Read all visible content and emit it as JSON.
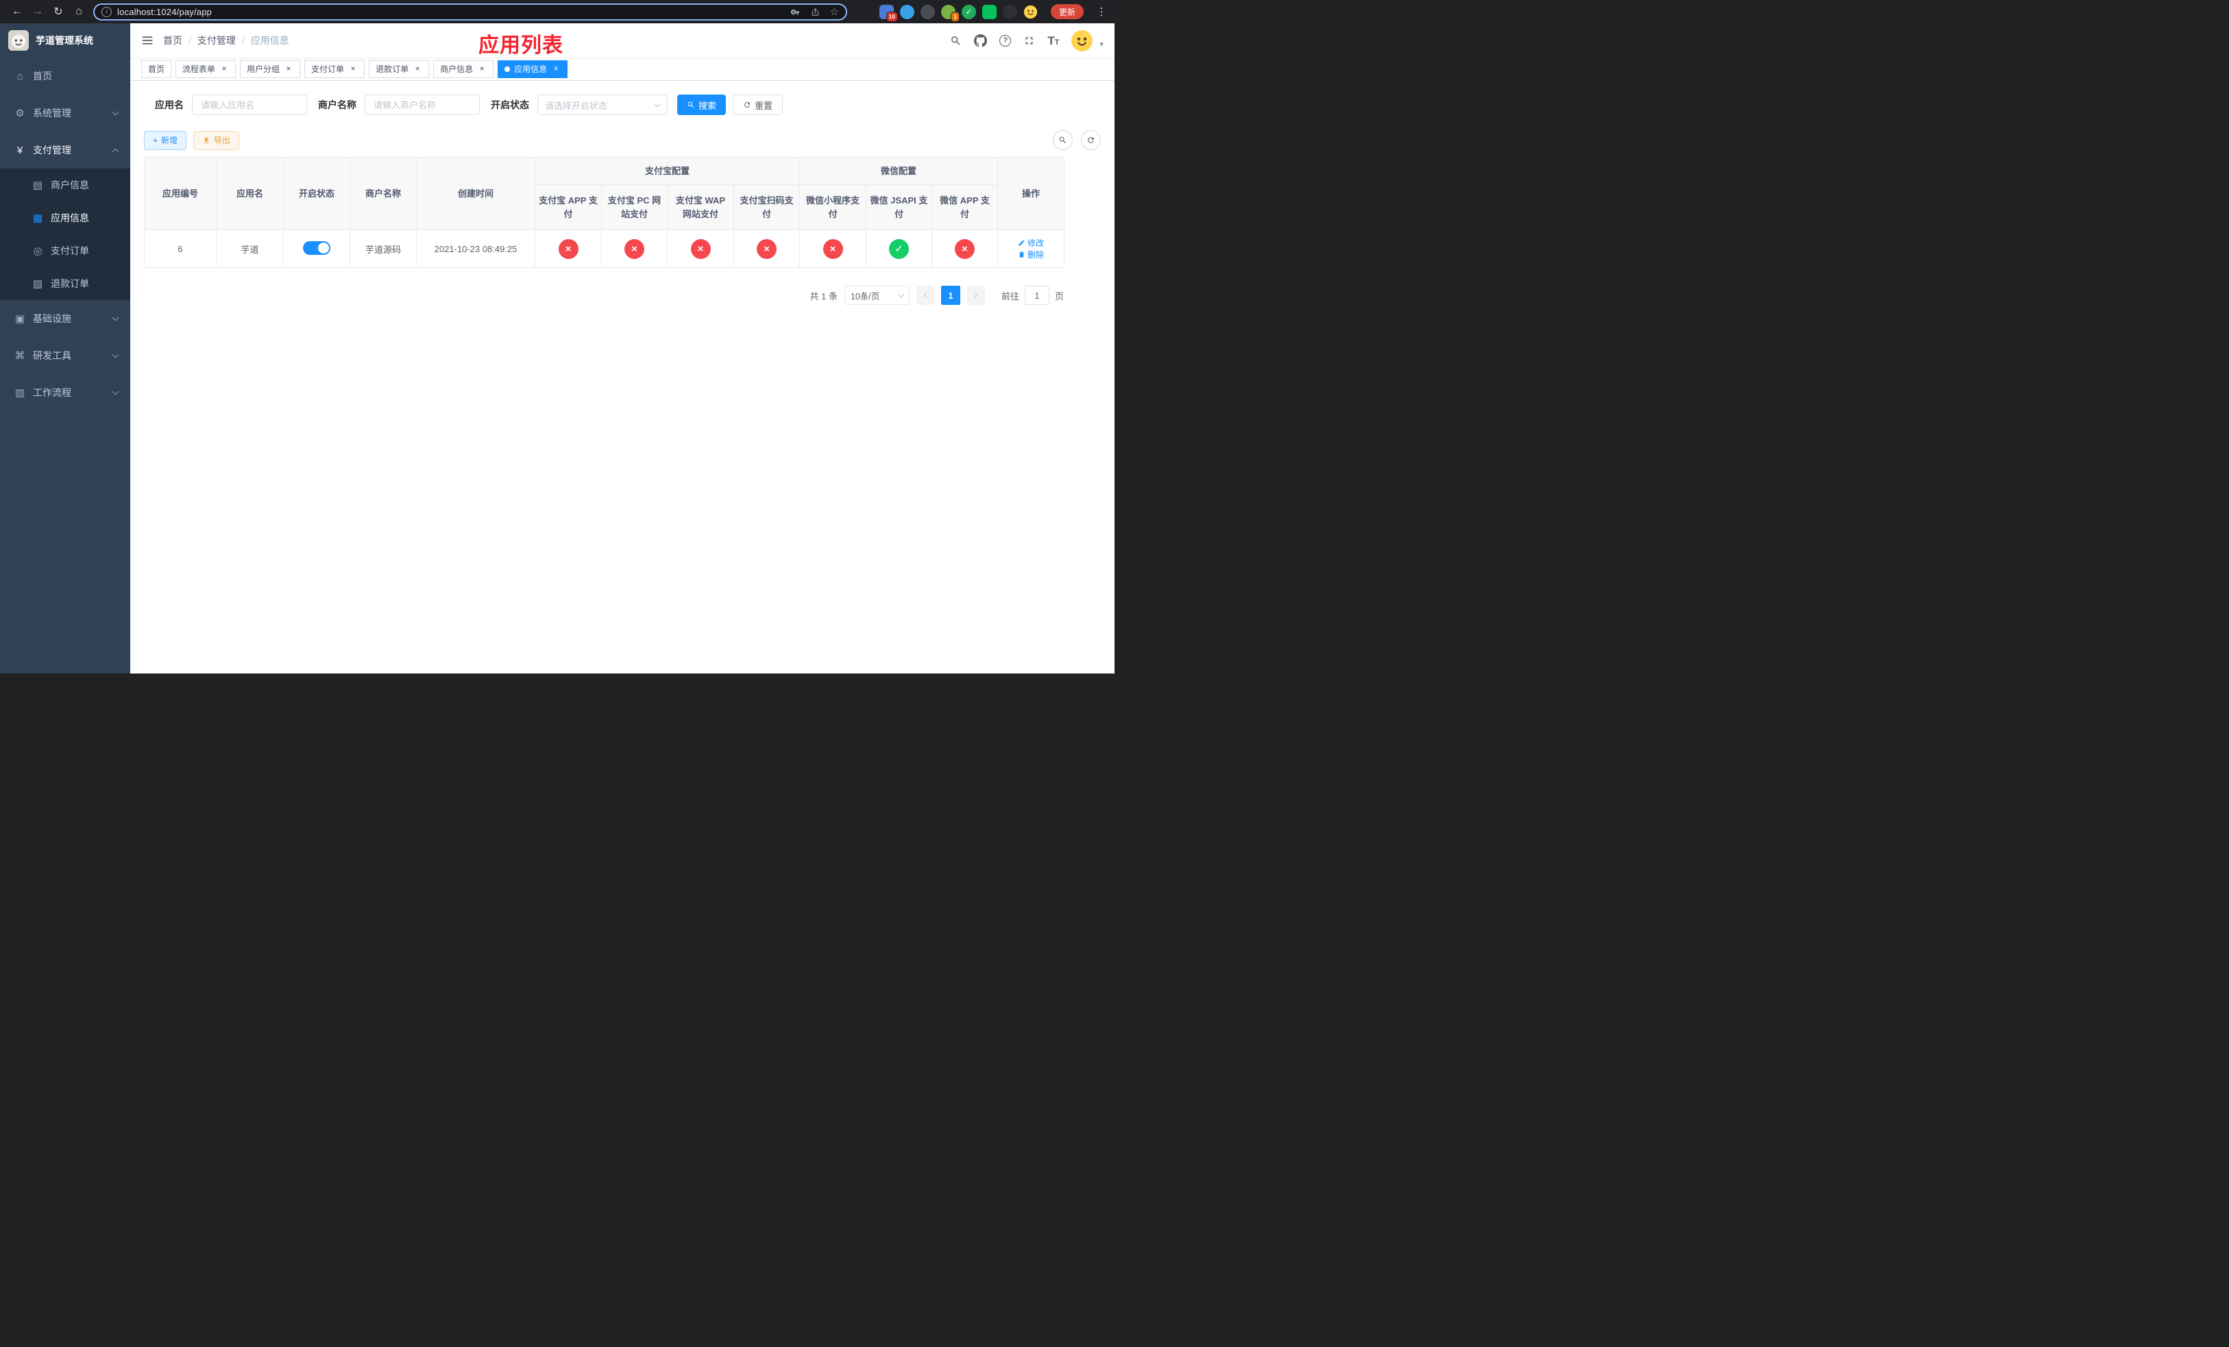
{
  "browser": {
    "url": "localhost:1024/pay/app",
    "update_button": "更新",
    "extension_badge": "10",
    "profile_badge": "1"
  },
  "icons": {
    "back": "←",
    "forward": "→",
    "reload": "↻",
    "browser_home": "⌂",
    "info": "i",
    "star": "☆",
    "menu_dots": "⋮",
    "font_size": "T",
    "help": "?",
    "home": "⌂",
    "system": "⚙",
    "payment": "¥",
    "merchant": "▤",
    "app": "▦",
    "pay_order": "◎",
    "refund_order": "▧",
    "infra": "▣",
    "devtools": "⌘",
    "workflow": "▥",
    "close": "×",
    "check": "✓",
    "cross": "×",
    "caret": "▾",
    "prev": "‹",
    "next": "›",
    "plus": "+"
  },
  "sidebar": {
    "logo_title": "芋道管理系统",
    "items": [
      {
        "label": "首页"
      },
      {
        "label": "系统管理"
      },
      {
        "label": "支付管理",
        "children": [
          {
            "label": "商户信息"
          },
          {
            "label": "应用信息"
          },
          {
            "label": "支付订单"
          },
          {
            "label": "退款订单"
          }
        ]
      },
      {
        "label": "基础设施"
      },
      {
        "label": "研发工具"
      },
      {
        "label": "工作流程"
      }
    ]
  },
  "header": {
    "breadcrumb": [
      "首页",
      "支付管理",
      "应用信息"
    ],
    "page_title": "应用列表"
  },
  "tabs": [
    {
      "label": "首页"
    },
    {
      "label": "流程表单"
    },
    {
      "label": "用户分组"
    },
    {
      "label": "支付订单"
    },
    {
      "label": "退款订单"
    },
    {
      "label": "商户信息"
    },
    {
      "label": "应用信息"
    }
  ],
  "filters": {
    "app_name_label": "应用名",
    "app_name_placeholder": "请输入应用名",
    "merchant_label": "商户名称",
    "merchant_placeholder": "请输入商户名称",
    "status_label": "开启状态",
    "status_placeholder": "请选择开启状态",
    "search": "搜索",
    "reset": "重置"
  },
  "toolbar": {
    "add": "新增",
    "export": "导出"
  },
  "table": {
    "groups": {
      "alipay": "支付宝配置",
      "wechat": "微信配置"
    },
    "columns": [
      "应用编号",
      "应用名",
      "开启状态",
      "商户名称",
      "创建时间",
      "支付宝 APP 支付",
      "支付宝 PC 网站支付",
      "支付宝 WAP 网站支付",
      "支付宝扫码支付",
      "微信小程序支付",
      "微信 JSAPI 支付",
      "微信 APP 支付",
      "操作"
    ],
    "rows": [
      {
        "id": "6",
        "name": "芋道",
        "enabled": true,
        "merchant": "芋道源码",
        "create_time": "2021-10-23 08:49:25",
        "channels": [
          "no",
          "no",
          "no",
          "no",
          "no",
          "yes",
          "no"
        ],
        "edit": "修改",
        "delete": "删除"
      }
    ]
  },
  "pagination": {
    "total": "共 1 条",
    "page_size": "10条/页",
    "page": "1",
    "goto": "前往",
    "goto_value": "1",
    "unit": "页"
  },
  "colors": {
    "primary": "#1890ff",
    "success": "#13ce66",
    "danger": "#f5484d",
    "warning": "#e6a23c",
    "title_red": "#f5222d",
    "sidebar_bg": "#304156",
    "sidebar_sub_bg": "#1f2d3d"
  }
}
